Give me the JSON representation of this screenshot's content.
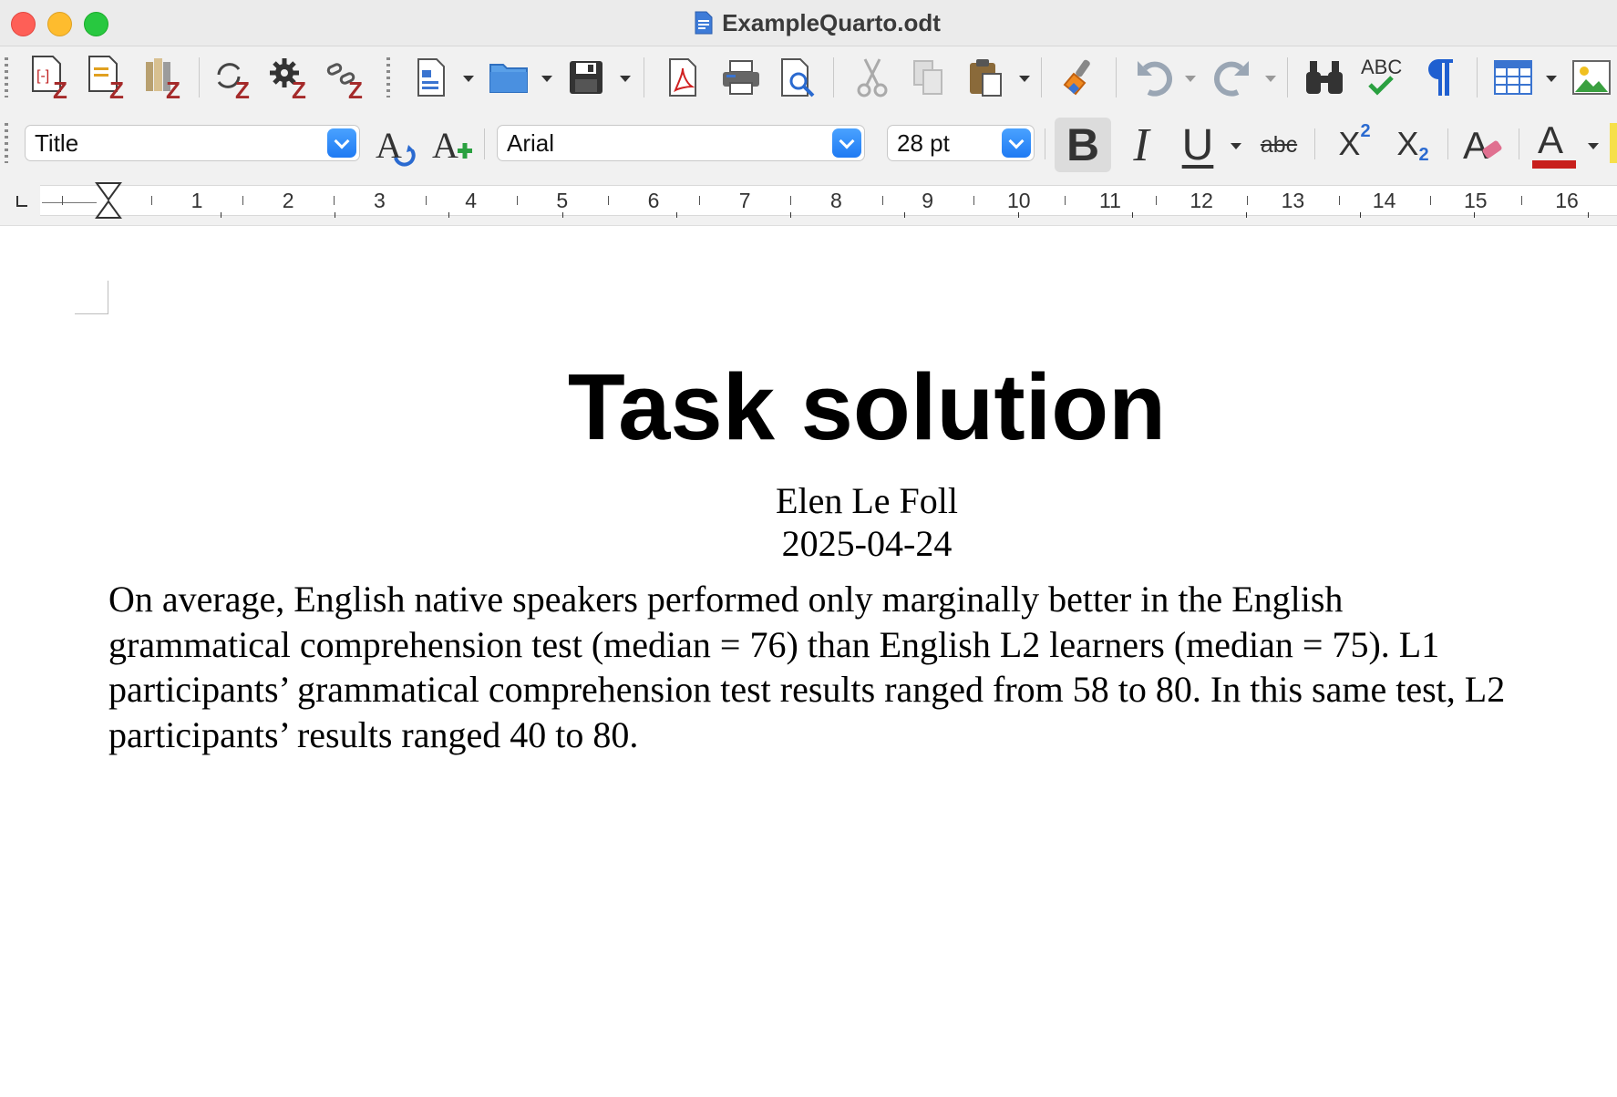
{
  "window": {
    "title": "ExampleQuarto.odt"
  },
  "toolbar_standard": {
    "icons": [
      "export-odt-icon",
      "export-doc-icon",
      "export-docx-icon",
      "sync-icon",
      "settings-icon",
      "unlink-icon",
      "new-document-icon",
      "open-folder-icon",
      "save-icon",
      "export-pdf-icon",
      "print-icon",
      "print-preview-icon",
      "cut-icon",
      "copy-icon",
      "paste-icon",
      "clone-formatting-icon",
      "undo-icon",
      "redo-icon",
      "find-replace-icon",
      "spellcheck-icon",
      "formatting-marks-icon",
      "insert-table-icon",
      "insert-image-icon"
    ]
  },
  "toolbar_formatting": {
    "paragraph_style": "Title",
    "font_name": "Arial",
    "font_size": "28 pt",
    "bold_label": "B",
    "italic_label": "I",
    "underline_label": "U",
    "strikethrough_label": "abc",
    "superscript_label": "X",
    "superscript_mark": "2",
    "subscript_label": "X",
    "subscript_mark": "2",
    "font_color_label": "A",
    "font_color": "#c8201d"
  },
  "ruler": {
    "numbers": [
      "1",
      "2",
      "3",
      "4",
      "5",
      "6",
      "7",
      "8",
      "9",
      "10",
      "11",
      "12",
      "13",
      "14",
      "15",
      "16"
    ]
  },
  "document": {
    "title": "Task solution",
    "author": "Elen Le Foll",
    "date": "2025-04-24",
    "paragraph_lines": [
      "On average, English native speakers performed only marginally better in the English",
      "grammatical comprehension test (median = 76) than English L2 learners (median = 75). L1",
      "participants’ grammatical comprehension test results ranged from 58 to 80. In this same test, L2",
      "participants’ results ranged 40 to 80."
    ]
  }
}
